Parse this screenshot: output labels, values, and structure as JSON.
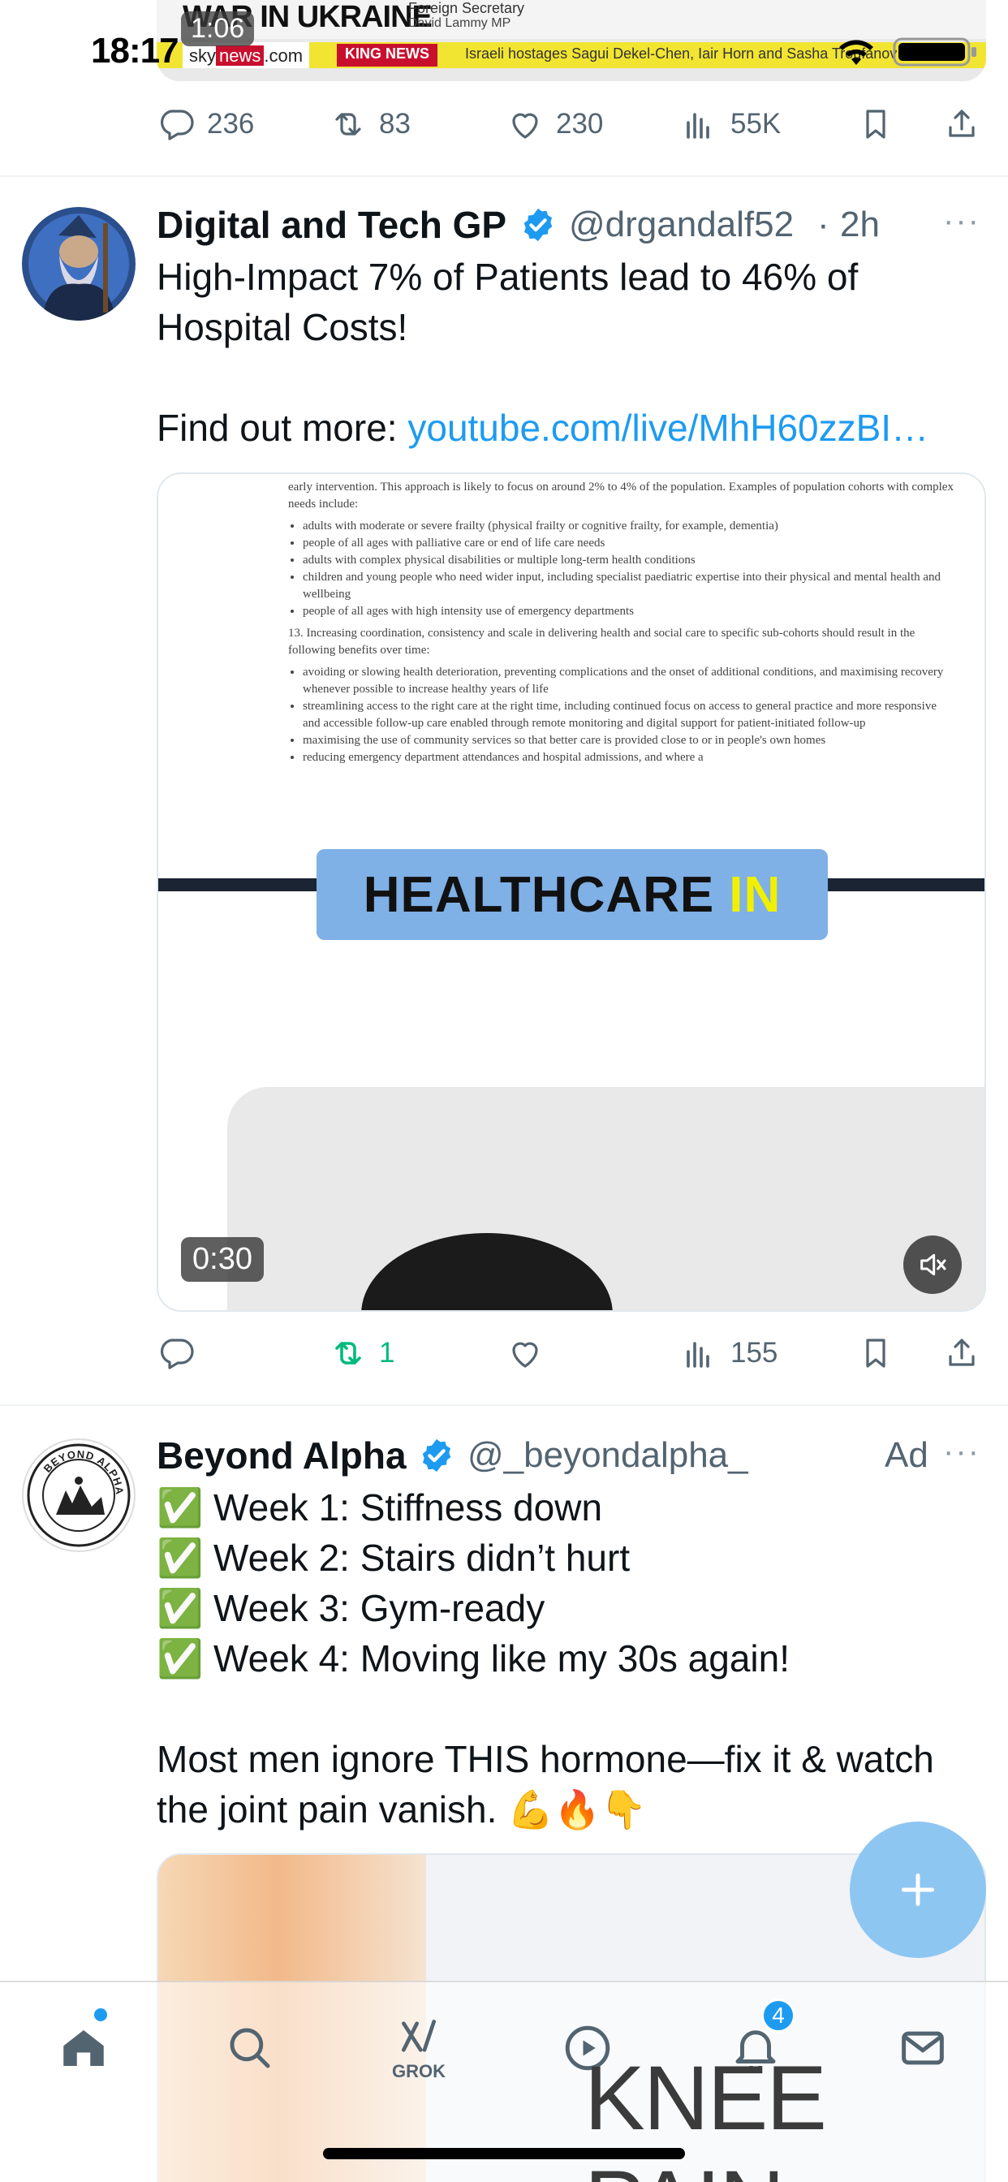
{
  "status_bar": {
    "time": "18:17"
  },
  "top_media": {
    "headline": "WAR IN UKRAINE",
    "caption_line1": "Foreign Secretary",
    "caption_line2": "David Lammy MP",
    "logo_prefix": "sky",
    "logo_news": "news",
    "logo_suffix": ".com",
    "ticker_tag": "KING NEWS",
    "ticker_text": "Israeli hostages Sagui Dekel-Chen, Iair Horn and Sasha Troufanov released",
    "video_time": "1:06"
  },
  "tweet0_actions": {
    "replies": "236",
    "reposts": "83",
    "likes": "230",
    "views": "55K"
  },
  "tweet1": {
    "name": "Digital and Tech GP",
    "handle": "@drgandalf52",
    "dot": "·",
    "time": "2h",
    "more": "···",
    "text_line1": "High-Impact 7% of Patients lead to 46% of",
    "text_line2": "Hospital Costs!",
    "link_prefix": "Find out more: ",
    "link": "youtube.com/live/MhH60zzBI…",
    "media": {
      "doc_intro": "early intervention. This approach is likely to focus on around 2% to 4% of the population. Examples of population cohorts with complex needs include:",
      "doc_bullets1": [
        "adults with moderate or severe frailty (physical frailty or cognitive frailty, for example, dementia)",
        "people of all ages with palliative care or end of life care needs",
        "adults with complex physical disabilities or multiple long-term health conditions",
        "children and young people who need wider input, including specialist paediatric expertise into their physical and mental health and wellbeing",
        "people of all ages with high intensity use of emergency departments"
      ],
      "doc_para13": "13. Increasing coordination, consistency and scale in delivering health and social care to specific sub-cohorts should result in the following benefits over time:",
      "doc_bullets2": [
        "avoiding or slowing health deterioration, preventing complications and the onset of additional conditions, and maximising recovery whenever possible to increase healthy years of life",
        "streamlining access to the right care at the right time, including continued focus on access to general practice and more responsive and accessible follow-up care enabled through remote monitoring and digital support for patient-initiated follow-up",
        "maximising the use of community services so that better care is provided close to or in people's own homes",
        "reducing emergency department attendances and hospital admissions, and where a"
      ],
      "banner_word1": "HEALTHCARE",
      "banner_word2": "IN",
      "video_time": "0:30"
    },
    "actions": {
      "replies": "",
      "reposts": "1",
      "likes": "",
      "views": "155"
    }
  },
  "tweet2": {
    "name": "Beyond Alpha",
    "handle": "@_beyondalpha_",
    "ad_label": "Ad",
    "more": "···",
    "avatar_text": "BEYOND ALPHA",
    "lines": [
      "✅ Week 1: Stiffness down",
      "✅ Week 2: Stairs didn’t hurt",
      "✅ Week 3: Gym-ready",
      "✅ Week 4: Moving like my 30s again!"
    ],
    "para_line1": "Most men ignore THIS hormone—fix it & watch",
    "para_line2": "the joint pain vanish. 💪🔥👇",
    "media_title": "KNEE PAIN"
  },
  "fab": {
    "label": "+"
  },
  "nav": {
    "grok_label": "GROK",
    "notifications_count": "4"
  },
  "colors": {
    "accent": "#1d9bf0",
    "repost_active": "#00ba7c",
    "secondary_text": "#536471"
  }
}
